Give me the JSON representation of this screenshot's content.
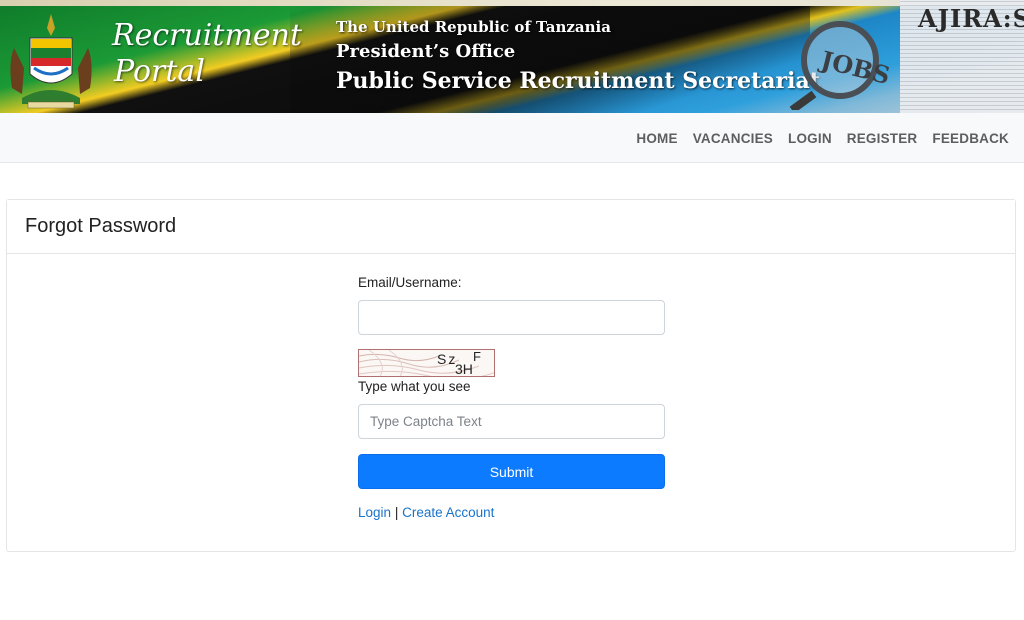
{
  "banner": {
    "portal_title_line1": "Recruitment",
    "portal_title_line2": "Portal",
    "org_line1": "The United Republic of Tanzania",
    "org_line2": "President’s Office",
    "org_line3": "Public Service Recruitment Secretariat",
    "news_title": "AJIRA:SE",
    "magnifier_text": "JOBS"
  },
  "nav": {
    "items": [
      {
        "label": "HOME"
      },
      {
        "label": "VACANCIES"
      },
      {
        "label": "LOGIN"
      },
      {
        "label": "REGISTER"
      },
      {
        "label": "FEEDBACK"
      }
    ]
  },
  "card": {
    "title": "Forgot Password"
  },
  "form": {
    "email_label": "Email/Username:",
    "email_value": "",
    "captcha_image_text": "Sz",
    "captcha_image_sub": "3H",
    "captcha_image_f": "F",
    "captcha_hint": "Type what you see",
    "captcha_placeholder": "Type Captcha Text",
    "submit_label": "Submit",
    "login_link": "Login",
    "separator": "|",
    "create_account_link": "Create Account"
  },
  "colors": {
    "primary_button": "#0d7bff",
    "link": "#1a73c9",
    "nav_text": "#5c5f62"
  }
}
